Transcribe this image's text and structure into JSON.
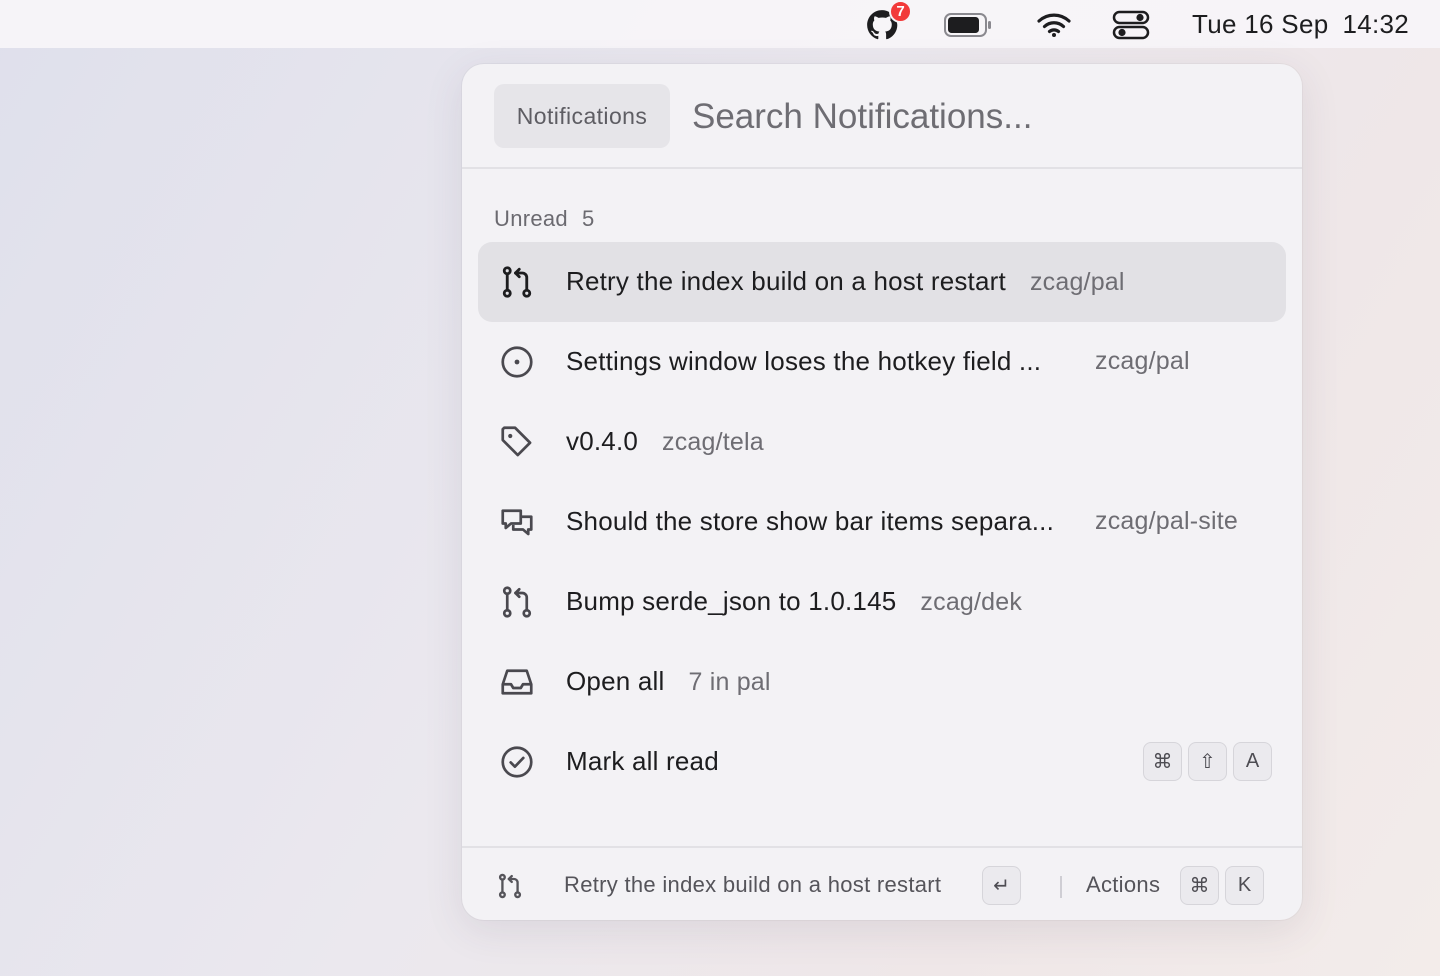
{
  "menubar": {
    "github_badge": "7",
    "date": "Tue 16 Sep",
    "time": "14:32",
    "icons": [
      "github-icon",
      "battery-icon",
      "wifi-icon",
      "control-center-icon"
    ]
  },
  "panel": {
    "scope_chip": "Notifications",
    "search_placeholder": "Search Notifications...",
    "section": {
      "label": "Unread",
      "count": "5"
    },
    "items": [
      {
        "icon": "pull-request-icon",
        "title": "Retry the index build on a host restart",
        "repo": "zcag/pal",
        "selected": true
      },
      {
        "icon": "issue-icon",
        "title": "Settings window loses the hotkey field ...",
        "repo": "zcag/pal"
      },
      {
        "icon": "tag-icon",
        "title": "v0.4.0",
        "repo": "zcag/tela"
      },
      {
        "icon": "discussion-icon",
        "title": "Should the store show bar items separa...",
        "repo": "zcag/pal-site"
      },
      {
        "icon": "pull-request-icon",
        "title": "Bump serde_json to 1.0.145",
        "repo": "zcag/dek"
      },
      {
        "icon": "inbox-icon",
        "title": "Open all",
        "repo": "7 in pal"
      },
      {
        "icon": "check-circle-icon",
        "title": "Mark all read",
        "shortcut": [
          "⌘",
          "⇧",
          "A"
        ]
      }
    ],
    "footer": {
      "icon": "pull-request-icon",
      "selected_title": "Retry the index build on a host restart",
      "enter_key": "↵",
      "actions_label": "Actions",
      "actions_keys": [
        "⌘",
        "K"
      ]
    }
  },
  "colors": {
    "badge": "#f23a3a",
    "panel_bg": "#f3f2f5",
    "selected_row": "#e2e1e5",
    "text_primary": "#1d1d1f",
    "text_secondary": "#6e6d73"
  }
}
